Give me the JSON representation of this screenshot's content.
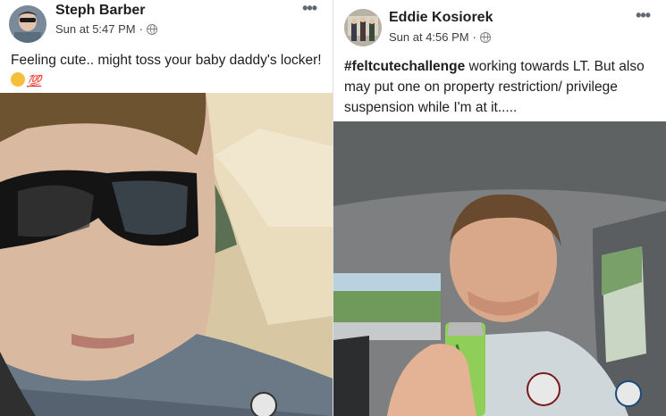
{
  "posts": [
    {
      "author": "Steph Barber",
      "timestamp": "Sun at 5:47 PM",
      "separator": "·",
      "more": "•••",
      "text": "Feeling cute.. might toss your baby daddy's locker!",
      "emoji_100": "💯"
    },
    {
      "author": "Eddie Kosiorek",
      "timestamp": "Sun at 4:56 PM",
      "separator": "·",
      "more": "•••",
      "hashtag": "#feltcutechallenge",
      "text": " working towards LT. But also may put one on property restriction/ privilege suspension while I'm at it....."
    }
  ],
  "icons": {
    "audience": "globe-icon",
    "options": "more-options-icon",
    "ok_hand": "ok-hand-emoji-icon",
    "hundred": "hundred-emoji-icon"
  },
  "colors": {
    "text": "#1c1e21",
    "meta": "#3b3d40",
    "emoji_red": "#e0242f"
  }
}
